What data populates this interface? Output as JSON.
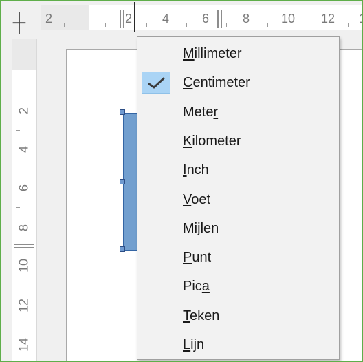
{
  "ruler": {
    "corner_symbol": "┼",
    "horizontal_labels": [
      "2",
      "2",
      "4",
      "6",
      "8",
      "10",
      "12",
      "1"
    ],
    "vertical_labels": [
      "2",
      "4",
      "6",
      "8",
      "10",
      "12",
      "14"
    ]
  },
  "menu": {
    "selected": "Centimeter",
    "items": [
      {
        "pre": "",
        "key": "M",
        "post": "illimeter"
      },
      {
        "pre": "",
        "key": "C",
        "post": "entimeter"
      },
      {
        "pre": "Mete",
        "key": "r",
        "post": ""
      },
      {
        "pre": "",
        "key": "K",
        "post": "ilometer"
      },
      {
        "pre": "",
        "key": "I",
        "post": "nch"
      },
      {
        "pre": "",
        "key": "V",
        "post": "oet"
      },
      {
        "pre": "Mi",
        "key": "j",
        "post": "len"
      },
      {
        "pre": "",
        "key": "P",
        "post": "unt"
      },
      {
        "pre": "Pic",
        "key": "a",
        "post": ""
      },
      {
        "pre": "",
        "key": "T",
        "post": "eken"
      },
      {
        "pre": "",
        "key": "L",
        "post": "ijn"
      }
    ]
  },
  "colors": {
    "frame_border": "#5fae4a",
    "shape_fill": "#729fcf",
    "check_highlight": "#aad4f5"
  }
}
